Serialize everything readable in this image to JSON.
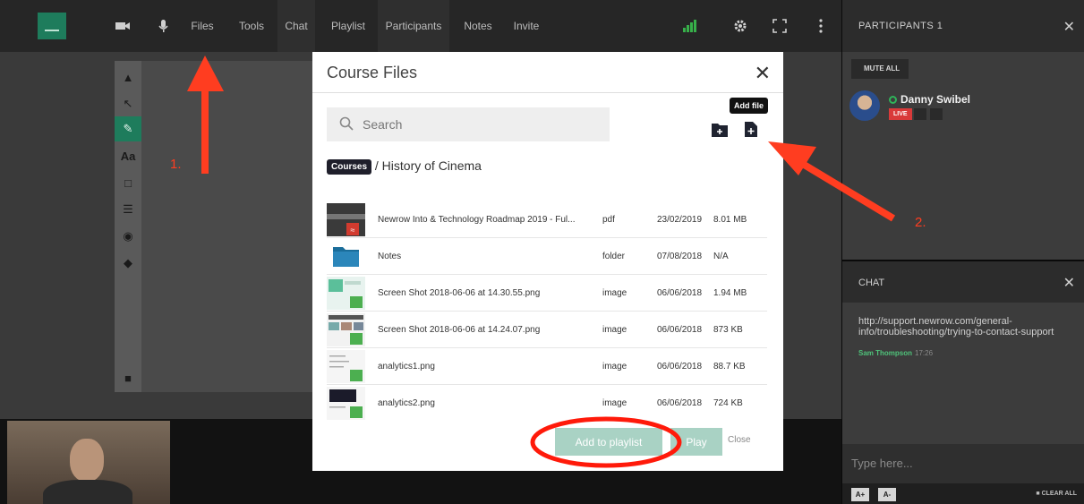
{
  "topbar": {
    "nav": [
      {
        "label": "Files"
      },
      {
        "label": "Tools"
      },
      {
        "label": "Chat"
      },
      {
        "label": "Playlist"
      },
      {
        "label": "Participants"
      },
      {
        "label": "Notes"
      },
      {
        "label": "Invite"
      }
    ],
    "icons": [
      "camera-icon",
      "microphone-icon",
      "signal-icon",
      "gear-icon",
      "fullscreen-icon",
      "more-icon"
    ]
  },
  "whiteboard_tools": [
    "select-icon",
    "pointer-icon",
    "pencil-icon",
    "text-tool",
    "rectangle-icon",
    "line-width-icon",
    "palette-icon",
    "eraser-icon",
    "trash-icon"
  ],
  "whiteboard_text_tool_label": "Aa",
  "participants": {
    "title": "PARTICIPANTS 1",
    "mute_all": "MUTE ALL",
    "user": {
      "name": "Danny Swibel",
      "badge": "LIVE"
    }
  },
  "chat": {
    "title": "CHAT",
    "message": "http://support.newrow.com/general-info/troubleshooting/trying-to-contact-support",
    "author": "Sam Thompson",
    "time": "17:26",
    "input_placeholder": "Type here...",
    "font_up": "A+",
    "font_down": "A-",
    "clear_all": "CLEAR ALL"
  },
  "modal": {
    "title": "Course Files",
    "search_placeholder": "Search",
    "tooltip": "Add file",
    "breadcrumb": {
      "root": "Courses",
      "current": "/ History of Cinema"
    },
    "files": [
      {
        "name": "Newrow Into & Technology Roadmap 2019 - Ful...",
        "type": "pdf",
        "date": "23/02/2019",
        "size": "8.01 MB"
      },
      {
        "name": "Notes",
        "type": "folder",
        "date": "07/08/2018",
        "size": "N/A"
      },
      {
        "name": "Screen Shot 2018-06-06 at 14.30.55.png",
        "type": "image",
        "date": "06/06/2018",
        "size": "1.94 MB"
      },
      {
        "name": "Screen Shot 2018-06-06 at 14.24.07.png",
        "type": "image",
        "date": "06/06/2018",
        "size": "873 KB"
      },
      {
        "name": "analytics1.png",
        "type": "image",
        "date": "06/06/2018",
        "size": "88.7 KB"
      },
      {
        "name": "analytics2.png",
        "type": "image",
        "date": "06/06/2018",
        "size": "724 KB"
      }
    ],
    "buttons": {
      "add_to_playlist": "Add to playlist",
      "play": "Play",
      "close": "Close"
    }
  },
  "annotations": {
    "label1": "1.",
    "label2": "2."
  },
  "colors": {
    "accent": "#1e7c5c",
    "annotation": "#ff3d20",
    "live": "#d93a3a",
    "button": "#a9d2c4"
  }
}
